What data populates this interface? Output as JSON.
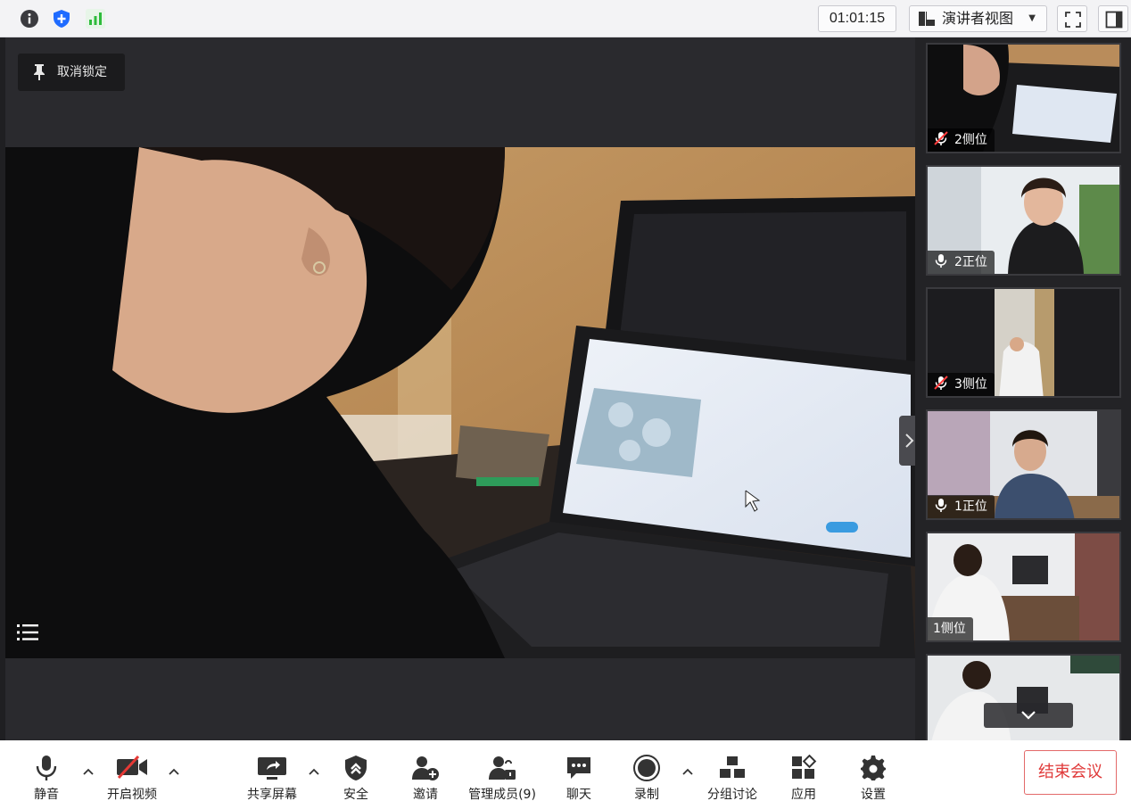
{
  "topbar": {
    "timer": "01:01:15",
    "view_mode": "演讲者视图"
  },
  "stage": {
    "pin_label": "取消锁定"
  },
  "tiles": [
    {
      "label": "2侧位",
      "mic": "muted"
    },
    {
      "label": "2正位",
      "mic": "on"
    },
    {
      "label": "3侧位",
      "mic": "muted"
    },
    {
      "label": "1正位",
      "mic": "on"
    },
    {
      "label": "1侧位",
      "mic": "none"
    },
    {
      "label": "",
      "mic": "none"
    }
  ],
  "toolbar": {
    "mute": "静音",
    "start_video": "开启视频",
    "share_screen": "共享屏幕",
    "security": "安全",
    "invite": "邀请",
    "manage_members": "管理成员(9)",
    "chat": "聊天",
    "record": "录制",
    "breakout": "分组讨论",
    "apps": "应用",
    "settings": "设置",
    "end_meeting": "结束会议"
  },
  "colors": {
    "accent_blue": "#1f6bff",
    "signal_green": "#2dbb3a",
    "end_red": "#e03a3a"
  }
}
